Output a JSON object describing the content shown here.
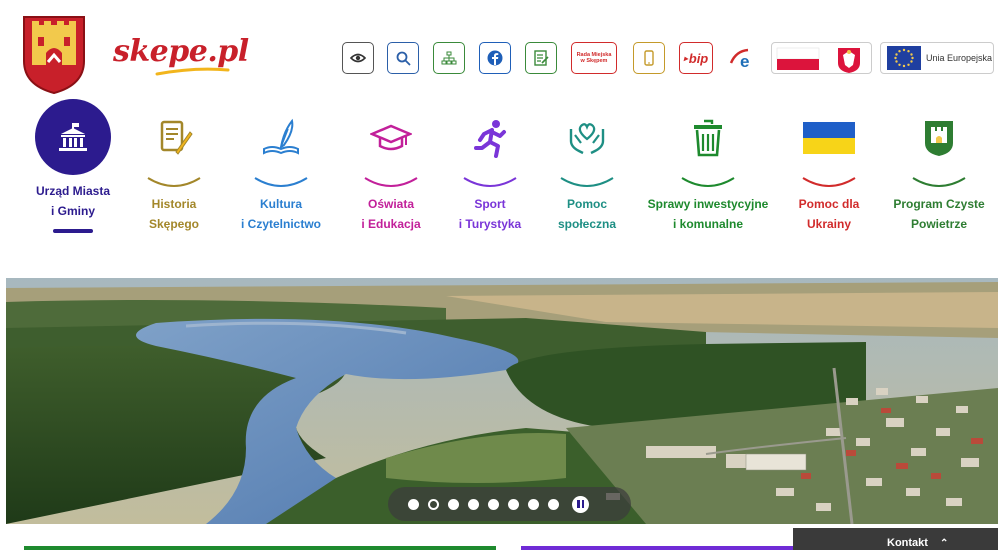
{
  "site": {
    "logo_text": "skepe.pl",
    "crest_icon": "town-crest-icon"
  },
  "toolbar": {
    "rada_line1": "Rada Miejska",
    "rada_line2": "w Skępem",
    "bip_label": "bip",
    "eu_label": "Unia Europejska",
    "icons": [
      "eye-icon",
      "search-icon",
      "sitemap-icon",
      "facebook-icon",
      "ecard-icon",
      "rada-button",
      "mobile-icon",
      "bip-icon",
      "epuap-icon",
      "poland-flag-icon",
      "eu-flag-icon"
    ]
  },
  "categories": [
    {
      "line1": "Urząd Miasta",
      "line2": "i Gminy",
      "color": "#2c1b8e",
      "icon": "city-hall-icon"
    },
    {
      "line1": "Historia",
      "line2": "Skępego",
      "color": "#a3872a",
      "icon": "document-quill-icon"
    },
    {
      "line1": "Kultura",
      "line2": "i Czytelnictwo",
      "color": "#2b7fd0",
      "icon": "book-quill-icon"
    },
    {
      "line1": "Oświata",
      "line2": "i Edukacja",
      "color": "#c2209a",
      "icon": "graduation-cap-icon"
    },
    {
      "line1": "Sport",
      "line2": "i Turystyka",
      "color": "#7a35d8",
      "icon": "runner-icon"
    },
    {
      "line1": "Pomoc",
      "line2": "społeczna",
      "color": "#1e8f84",
      "icon": "heart-hands-icon"
    },
    {
      "line1": "Sprawy inwestycyjne",
      "line2": "i komunalne",
      "color": "#1e8a2e",
      "icon": "trash-bin-icon"
    },
    {
      "line1": "Pomoc dla",
      "line2": "Ukrainy",
      "color": "#d12b2b",
      "icon": "ukraine-flag-icon"
    },
    {
      "line1": "Program Czyste",
      "line2": "Powietrze",
      "color": "#2e7d32",
      "icon": "castle-badge-icon"
    }
  ],
  "hero": {
    "slides": 8,
    "active_slide": 2
  },
  "footer": {
    "kontakt_label": "Kontakt",
    "kontakt_icon": "chevron-up-icon"
  }
}
